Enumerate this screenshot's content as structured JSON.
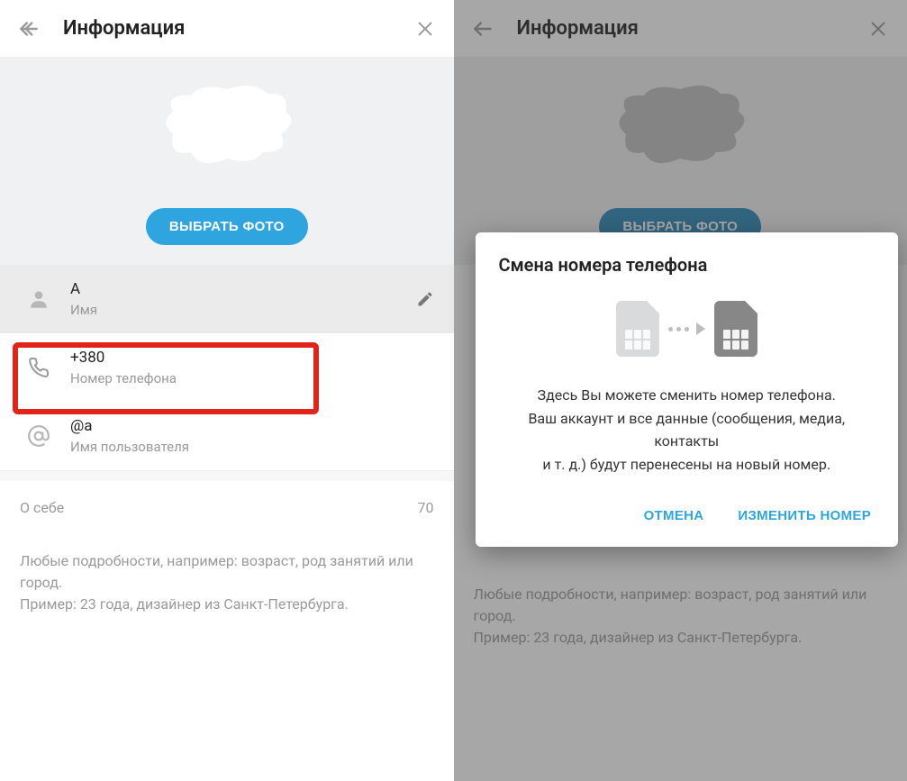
{
  "left": {
    "header": {
      "title": "Информация"
    },
    "choosePhoto": "ВЫБРАТЬ ФОТО",
    "name": {
      "value": "A",
      "label": "Имя"
    },
    "phone": {
      "value": "+380",
      "label": "Номер телефона"
    },
    "username": {
      "value": "@a",
      "label": "Имя пользователя"
    },
    "about": {
      "heading": "О себе",
      "counter": "70",
      "hint1": "Любые подробности, например: возраст, род занятий или город.",
      "hint2": "Пример: 23 года, дизайнер из Санкт-Петербурга."
    }
  },
  "right": {
    "header": {
      "title": "Информация"
    },
    "choosePhoto": "ВЫБРАТЬ ФОТО",
    "about": {
      "hint1": "Любые подробности, например: возраст, род занятий или город.",
      "hint2": "Пример: 23 года, дизайнер из Санкт-Петербурга."
    },
    "modal": {
      "title": "Смена номера телефона",
      "body1": "Здесь Вы можете сменить номер телефона.",
      "body2": "Ваш аккаунт и все данные (сообщения, медиа, контакты",
      "body3": "и т. д.) будут перенесены на новый номер.",
      "cancel": "ОТМЕНА",
      "confirm": "ИЗМЕНИТЬ НОМЕР"
    }
  }
}
